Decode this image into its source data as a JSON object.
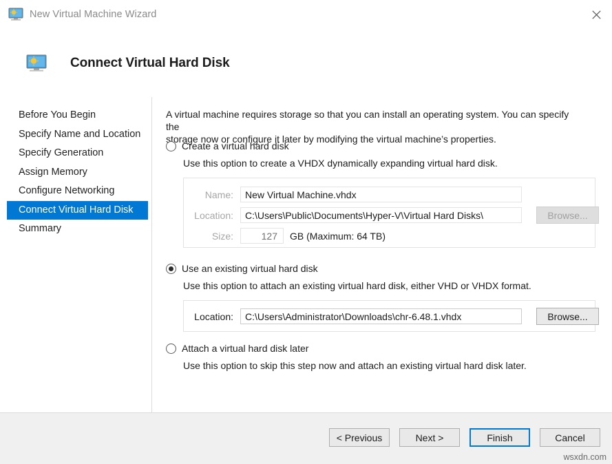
{
  "window": {
    "title": "New Virtual Machine Wizard",
    "icon": "virtual-machine-icon",
    "close_label": "✕"
  },
  "header": {
    "icon": "virtual-machine-icon",
    "title": "Connect Virtual Hard Disk"
  },
  "sidebar": {
    "items": [
      {
        "label": "Before You Begin",
        "selected": false
      },
      {
        "label": "Specify Name and Location",
        "selected": false
      },
      {
        "label": "Specify Generation",
        "selected": false
      },
      {
        "label": "Assign Memory",
        "selected": false
      },
      {
        "label": "Configure Networking",
        "selected": false
      },
      {
        "label": "Connect Virtual Hard Disk",
        "selected": true
      },
      {
        "label": "Summary",
        "selected": false
      }
    ],
    "selected_color": "#0078d4"
  },
  "main": {
    "intro_line1": "A virtual machine requires storage so that you can install an operating system. You can specify the",
    "intro_line2": "storage now or configure it later by modifying the virtual machine’s properties.",
    "options": [
      {
        "id": "create",
        "label": "Create a virtual hard disk",
        "description": "Use this option to create a VHDX dynamically expanding virtual hard disk.",
        "selected": false,
        "enabled": false
      },
      {
        "id": "existing",
        "label": "Use an existing virtual hard disk",
        "description": "Use this option to attach an existing virtual hard disk, either VHD or VHDX format.",
        "selected": true,
        "enabled": true
      },
      {
        "id": "later",
        "label": "Attach a virtual hard disk later",
        "description": "Use this option to skip this step now and attach an existing virtual hard disk later.",
        "selected": false,
        "enabled": false
      }
    ],
    "create_panel": {
      "name_label": "Name:",
      "name_value": "New Virtual Machine.vhdx",
      "location_label": "Location:",
      "location_value": "C:\\Users\\Public\\Documents\\Hyper-V\\Virtual Hard Disks\\",
      "location_browse_label": "Browse...",
      "size_label": "Size:",
      "size_value": "127",
      "size_suffix": "GB (Maximum: 64 TB)"
    },
    "existing_panel": {
      "location_label": "Location:",
      "location_value": "C:\\Users\\Administrator\\Downloads\\chr-6.48.1.vhdx",
      "browse_label": "Browse..."
    }
  },
  "footer": {
    "previous_label": "< Previous",
    "next_label": "Next >",
    "finish_label": "Finish",
    "cancel_label": "Cancel",
    "default_button": "Finish",
    "accent_color": "#0078d4"
  },
  "watermark": {
    "text": "wsxdn.com"
  }
}
